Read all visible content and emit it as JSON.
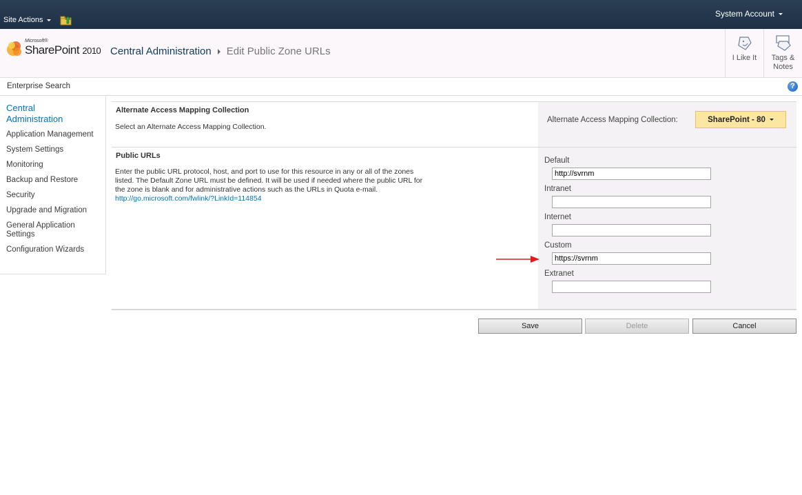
{
  "ribbon": {
    "site_actions": "Site Actions",
    "account": "System Account"
  },
  "title_area": {
    "logo_microsoft": "Microsoft®",
    "logo_product": "SharePoint",
    "logo_year": "2010",
    "breadcrumb_root": "Central Administration",
    "breadcrumb_current": "Edit Public Zone URLs",
    "i_like_it": "I Like It",
    "tags_notes_1": "Tags &",
    "tags_notes_2": "Notes"
  },
  "top_bar": {
    "enterprise_search": "Enterprise Search",
    "help": "?"
  },
  "left_nav": {
    "heading_1": "Central",
    "heading_2": "Administration",
    "items": [
      "Application Management",
      "System Settings",
      "Monitoring",
      "Backup and Restore",
      "Security",
      "Upgrade and Migration",
      "General Application",
      "Settings",
      "Configuration Wizards"
    ]
  },
  "aam_section": {
    "title": "Alternate Access Mapping Collection",
    "description": "Select an Alternate Access Mapping Collection.",
    "label": "Alternate Access Mapping Collection:",
    "selected": "SharePoint - 80"
  },
  "urls_section": {
    "title": "Public URLs",
    "desc_line1": "Enter the public URL protocol, host, and port to use for this resource in any or all of the zones",
    "desc_line2": "listed.  The Default Zone URL must be defined.  It will be used if needed where the public URL for",
    "desc_line3": "the zone is blank and for administrative actions such as the URLs in Quota e-mail.",
    "link": "http://go.microsoft.com/fwlink/?LinkId=114854",
    "zones": [
      {
        "label": "Default",
        "value": "http://svrnm"
      },
      {
        "label": "Intranet",
        "value": ""
      },
      {
        "label": "Internet",
        "value": ""
      },
      {
        "label": "Custom",
        "value": "https://svrnm"
      },
      {
        "label": "Extranet",
        "value": ""
      }
    ]
  },
  "buttons": {
    "save": "Save",
    "delete": "Delete",
    "cancel": "Cancel"
  },
  "colors": {
    "ribbon_bg": "#21374c",
    "accent_link": "#0072bc",
    "dropdown_bg": "#fbe7a1",
    "arrow": "#e01b1b"
  }
}
